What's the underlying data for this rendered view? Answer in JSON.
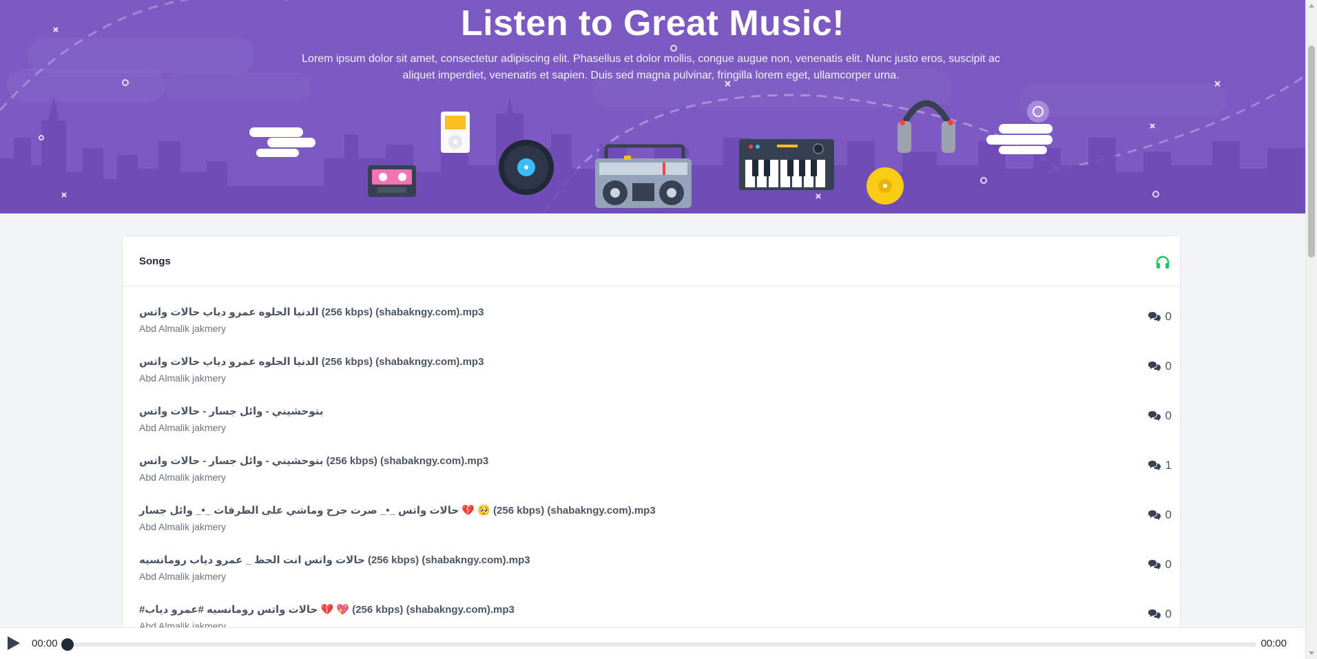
{
  "hero": {
    "title": "Listen to Great Music!",
    "description": "Lorem ipsum dolor sit amet, consectetur adipiscing elit. Phasellus et dolor mollis, congue augue non, venenatis elit. Nunc justo eros, suscipit ac aliquet imperdiet, venenatis et sapien. Duis sed magna pulvinar, fringilla lorem eget, ullamcorper urna.",
    "background_color": "#7c5ac2"
  },
  "songs_panel": {
    "title": "Songs",
    "header_icon": "headphones-icon",
    "accent_color": "#22c55e",
    "items": [
      {
        "title": "الدنيا الحلوه عمرو دياب حالات واتس (256 kbps) (shabakngy.com).mp3",
        "artist": "Abd Almalik jakmery",
        "comments": "0"
      },
      {
        "title": "الدنيا الحلوه عمرو دياب حالات واتس (256 kbps) (shabakngy.com).mp3",
        "artist": "Abd Almalik jakmery",
        "comments": "0"
      },
      {
        "title": "بتوحشيني - وائل جسار - حالات واتس",
        "artist": "Abd Almalik jakmery",
        "comments": "0"
      },
      {
        "title": "بتوحشيني - وائل جسار - حالات واتس (256 kbps) (shabakngy.com).mp3",
        "artist": "Abd Almalik jakmery",
        "comments": "1"
      },
      {
        "title": "حالات واتس _•_ صرت جرح وماشي على الطرقات _•_ وائل جسار 💔 🥺 (256 kbps) (shabakngy.com).mp3",
        "artist": "Abd Almalik jakmery",
        "comments": "0"
      },
      {
        "title": "حالات واتس انت الحظ _ عمرو دياب رومانسيه (256 kbps) (shabakngy.com).mp3",
        "artist": "Abd Almalik jakmery",
        "comments": "0"
      },
      {
        "title": "#حالات واتس رومانسيه #عمرو دياب 💔 💖 (256 kbps) (shabakngy.com).mp3",
        "artist": "Abd Almalik jakmery",
        "comments": "0"
      }
    ]
  },
  "player": {
    "current_time": "00:00",
    "duration": "00:00",
    "progress": 0,
    "play_icon": "play-icon"
  }
}
